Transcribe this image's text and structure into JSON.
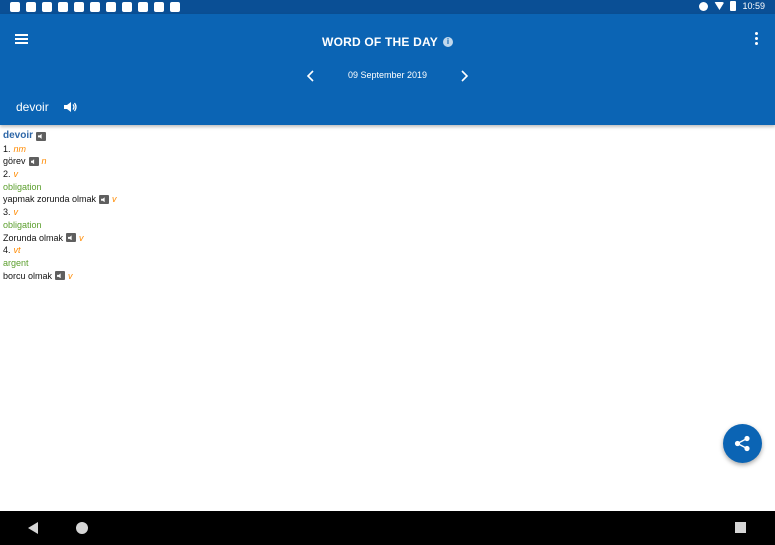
{
  "status_bar": {
    "time": "10:59",
    "notification_icons": [
      "drive-icon",
      "news-icon",
      "doc-icon",
      "doc-icon",
      "doc-icon",
      "doc-icon",
      "doc-icon",
      "doc-icon",
      "phone-icon",
      "youtube-icon",
      "image-icon"
    ],
    "system_icons": [
      "dnd-icon",
      "wifi-icon",
      "battery-icon"
    ]
  },
  "app_bar": {
    "title": "WORD OF THE DAY",
    "info_icon": "i",
    "date": "09 September 2019",
    "word": "devoir",
    "colors": {
      "primary": "#0b64b4",
      "status": "#0a4f95"
    }
  },
  "entry": {
    "headword": "devoir",
    "senses": [
      {
        "number": "1.",
        "pos": "nm",
        "meaning": "",
        "translation": "görev",
        "translation_pos": "n"
      },
      {
        "number": "2.",
        "pos": "v",
        "meaning": "obligation",
        "translation": "yapmak zorunda olmak",
        "translation_pos": "v"
      },
      {
        "number": "3.",
        "pos": "v",
        "meaning": "obligation",
        "translation": "Zorunda olmak",
        "translation_pos": "v"
      },
      {
        "number": "4.",
        "pos": "vt",
        "meaning": "argent",
        "translation": "borcu olmak",
        "translation_pos": "v"
      }
    ],
    "colors": {
      "headword": "#2e67a8",
      "pos": "#ff8a00",
      "meaning": "#5c9f2e"
    }
  }
}
